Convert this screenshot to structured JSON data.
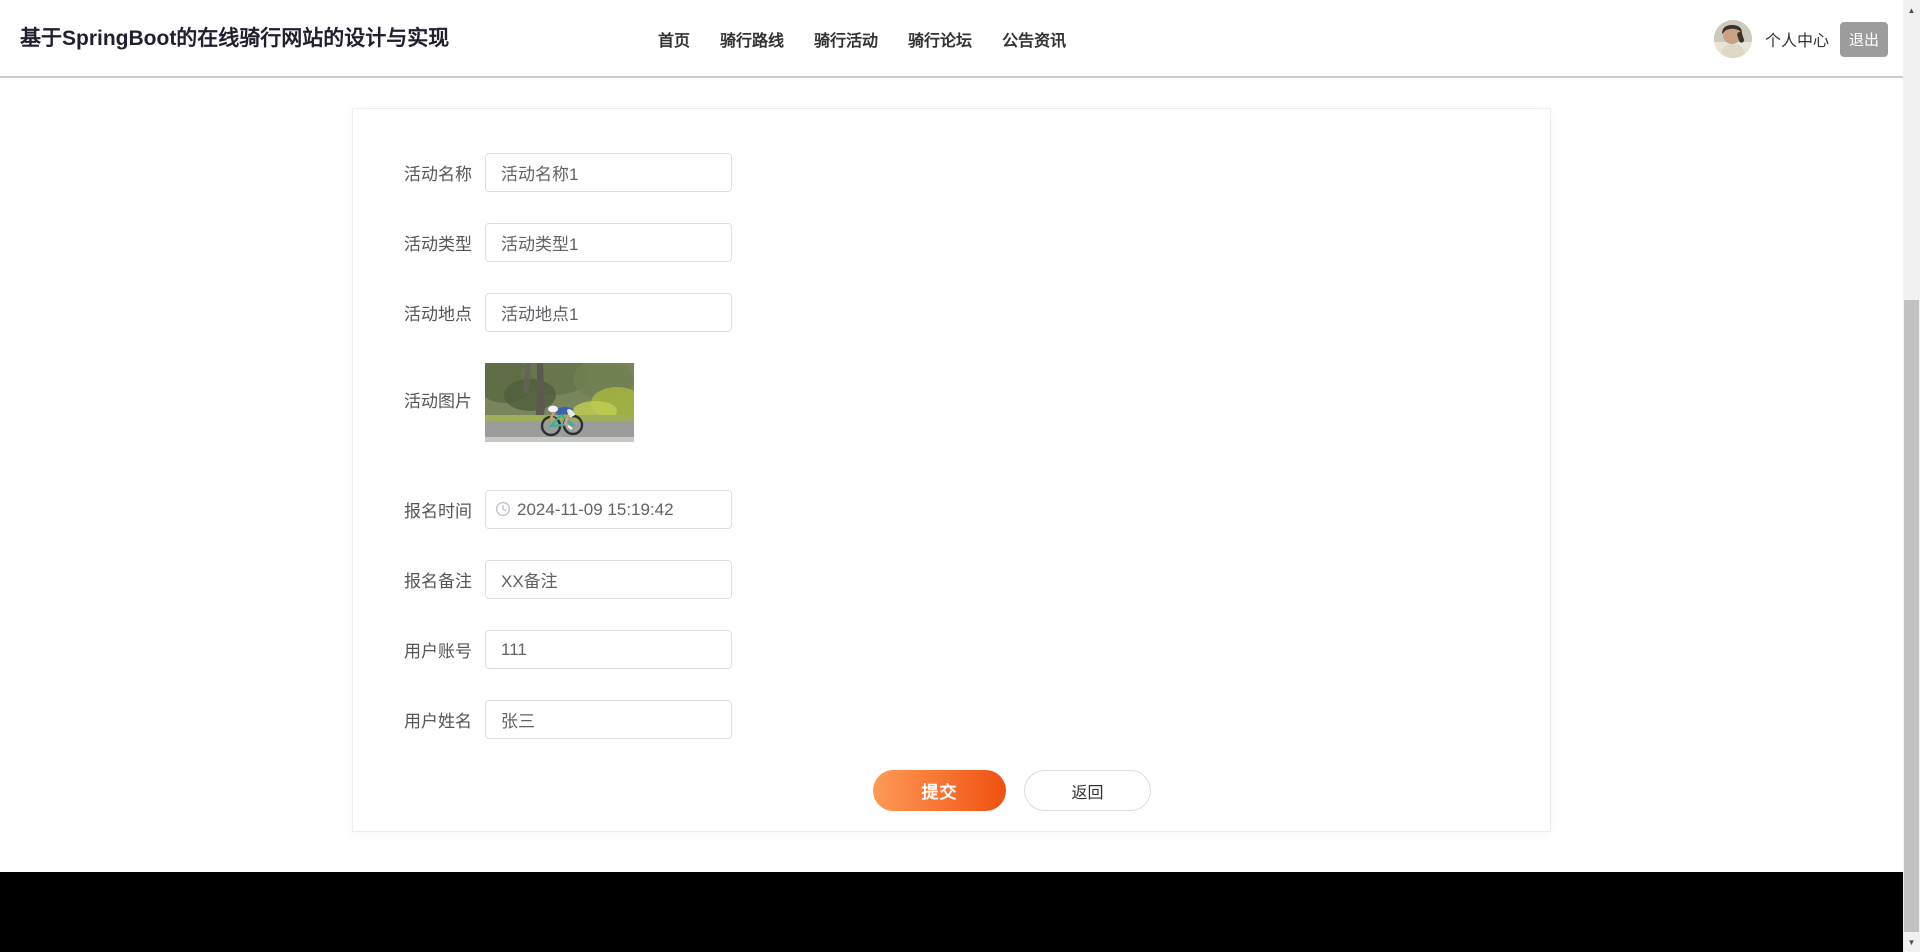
{
  "app": {
    "title": "基于SpringBoot的在线骑行网站的设计与实现"
  },
  "nav": {
    "items": [
      {
        "label": "首页"
      },
      {
        "label": "骑行路线"
      },
      {
        "label": "骑行活动"
      },
      {
        "label": "骑行论坛"
      },
      {
        "label": "公告资讯"
      }
    ]
  },
  "user_area": {
    "avatar_icon": "user-avatar-photo",
    "profile_label": "个人中心",
    "logout_label": "退出"
  },
  "form": {
    "fields": [
      {
        "label": "活动名称",
        "value": "活动名称1"
      },
      {
        "label": "活动类型",
        "value": "活动类型1"
      },
      {
        "label": "活动地点",
        "value": "活动地点1"
      },
      {
        "label": "活动图片",
        "image_icon": "cyclist-road-photo"
      },
      {
        "label": "报名时间",
        "value": "2024-11-09 15:19:42",
        "icon": "clock-icon"
      },
      {
        "label": "报名备注",
        "value": "XX备注"
      },
      {
        "label": "用户账号",
        "value": "111"
      },
      {
        "label": "用户姓名",
        "value": "张三"
      }
    ],
    "buttons": {
      "submit": "提交",
      "back": "返回"
    }
  },
  "scrollbar": {
    "up_glyph": "▲",
    "down_glyph": "▼"
  },
  "colors": {
    "submit_gradient_start": "#ff9a57",
    "submit_gradient_end": "#f05010",
    "logout_button_bg": "#9c9c9c",
    "header_border": "#cccccc",
    "input_border": "#dcdfe6",
    "footer_bg": "#000000",
    "scrollbar_track": "#f1f1f1",
    "scrollbar_thumb": "#c1c1c1"
  }
}
